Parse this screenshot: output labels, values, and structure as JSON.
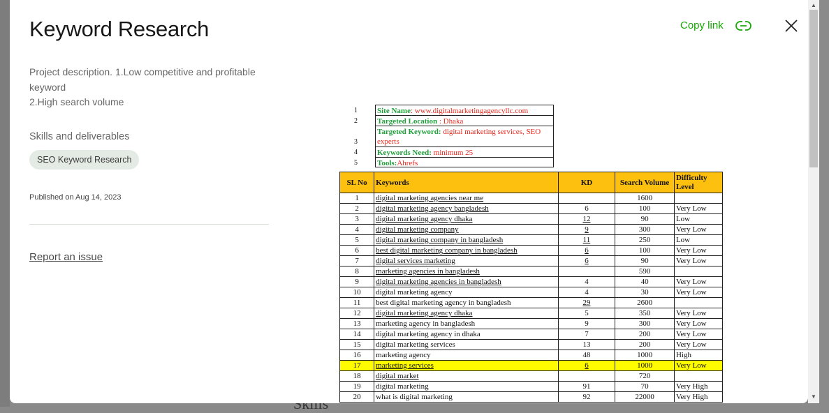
{
  "modal": {
    "title": "Keyword Research",
    "copy_link": "Copy link",
    "description_line1": "Project description. 1.Low competitive and profitable keyword",
    "description_line2": "2.High search volume",
    "skills_heading": "Skills and deliverables",
    "skill_chip": "SEO Keyword Research",
    "published": "Published on Aug 14, 2023",
    "report": "Report an issue"
  },
  "background": {
    "partial_text": "Skills"
  },
  "doc": {
    "info": [
      {
        "num": "1",
        "label": "Site Name",
        "sep": ": ",
        "value": "www.digitalmarketingagencyllc.com"
      },
      {
        "num": "2",
        "label": "Targeted Location",
        "sep": " : ",
        "value": "Dhaka"
      },
      {
        "num": "3",
        "label": "Targeted Keyword:",
        "sep": " ",
        "value": "digital marketing services, SEO experts"
      },
      {
        "num": "4",
        "label": "Keywords Need:",
        "sep": " ",
        "value": "minimum 25"
      },
      {
        "num": "5",
        "label": "Tools:",
        "sep": "",
        "value": "Ahrefs"
      }
    ],
    "headers": {
      "sl": "SL No",
      "kw": "Keywords",
      "kd": "KD",
      "sv": "Search Volume",
      "dl": "Difficulty Level"
    },
    "rows": [
      {
        "sl": "1",
        "kw": "digital marketing agencies near me",
        "kd": "",
        "sv": "1600",
        "dl": ""
      },
      {
        "sl": "2",
        "kw": "digital marketing agency bangladesh",
        "kd": "6",
        "sv": "100",
        "dl": "Very Low"
      },
      {
        "sl": "3",
        "kw": "digital marketing agency dhaka",
        "kd": "12",
        "sv": "90",
        "dl": "Low"
      },
      {
        "sl": "4",
        "kw": "digital marketing company",
        "kd": "9",
        "sv": "300",
        "dl": "Very Low"
      },
      {
        "sl": "5",
        "kw": "digital marketing company in  bangladesh",
        "kd": "11",
        "sv": "250",
        "dl": "Low"
      },
      {
        "sl": "6",
        "kw": "best digital marketing company in  bangladesh",
        "kd": "6",
        "sv": "100",
        "dl": "Very Low"
      },
      {
        "sl": "7",
        "kw": "digital services marketing",
        "kd": "6",
        "sv": "90",
        "dl": "Very Low"
      },
      {
        "sl": "8",
        "kw": "marketing agencies in bangladesh",
        "kd": "",
        "sv": "590",
        "dl": ""
      },
      {
        "sl": "9",
        "kw": "digital marketing agencies in bangladesh",
        "kd": "4",
        "sv": "40",
        "dl": "Very Low"
      },
      {
        "sl": "10",
        "kw": "digital marketing agency",
        "kd": "4",
        "sv": "30",
        "dl": "Very Low"
      },
      {
        "sl": "11",
        "kw": "best digital marketing agency in bangladesh",
        "kd": "29",
        "sv": "2600",
        "dl": ""
      },
      {
        "sl": "12",
        "kw": "digital marketing agency dhaka",
        "kd": "5",
        "sv": "350",
        "dl": "Very Low"
      },
      {
        "sl": "13",
        "kw": "marketing agency in bangladesh",
        "kd": "9",
        "sv": "300",
        "dl": "Very Low"
      },
      {
        "sl": "14",
        "kw": "digital marketing agency in dhaka",
        "kd": "7",
        "sv": "200",
        "dl": "Very Low"
      },
      {
        "sl": "15",
        "kw": "digital marketing services",
        "kd": "13",
        "sv": "200",
        "dl": "Very Low"
      },
      {
        "sl": "16",
        "kw": "marketing agency",
        "kd": "48",
        "sv": "1000",
        "dl": "High"
      },
      {
        "sl": "17",
        "kw": "marketing services",
        "kd": "6",
        "sv": "1000",
        "dl": "Very Low"
      },
      {
        "sl": "18",
        "kw": "digital market",
        "kd": "",
        "sv": "720",
        "dl": ""
      },
      {
        "sl": "19",
        "kw": "digital marketing",
        "kd": "91",
        "sv": "70",
        "dl": "Very High"
      },
      {
        "sl": "20",
        "kw": "what is digital marketing",
        "kd": "92",
        "sv": "22000",
        "dl": "Very High"
      }
    ]
  },
  "colors": {
    "accent": "#14a800",
    "header_fill": "#fec00f",
    "highlight": "#fffc00",
    "info_label": "#1f9e3a",
    "info_value": "#e8241b"
  },
  "icons": {
    "link": "link-icon",
    "close": "close-icon"
  }
}
